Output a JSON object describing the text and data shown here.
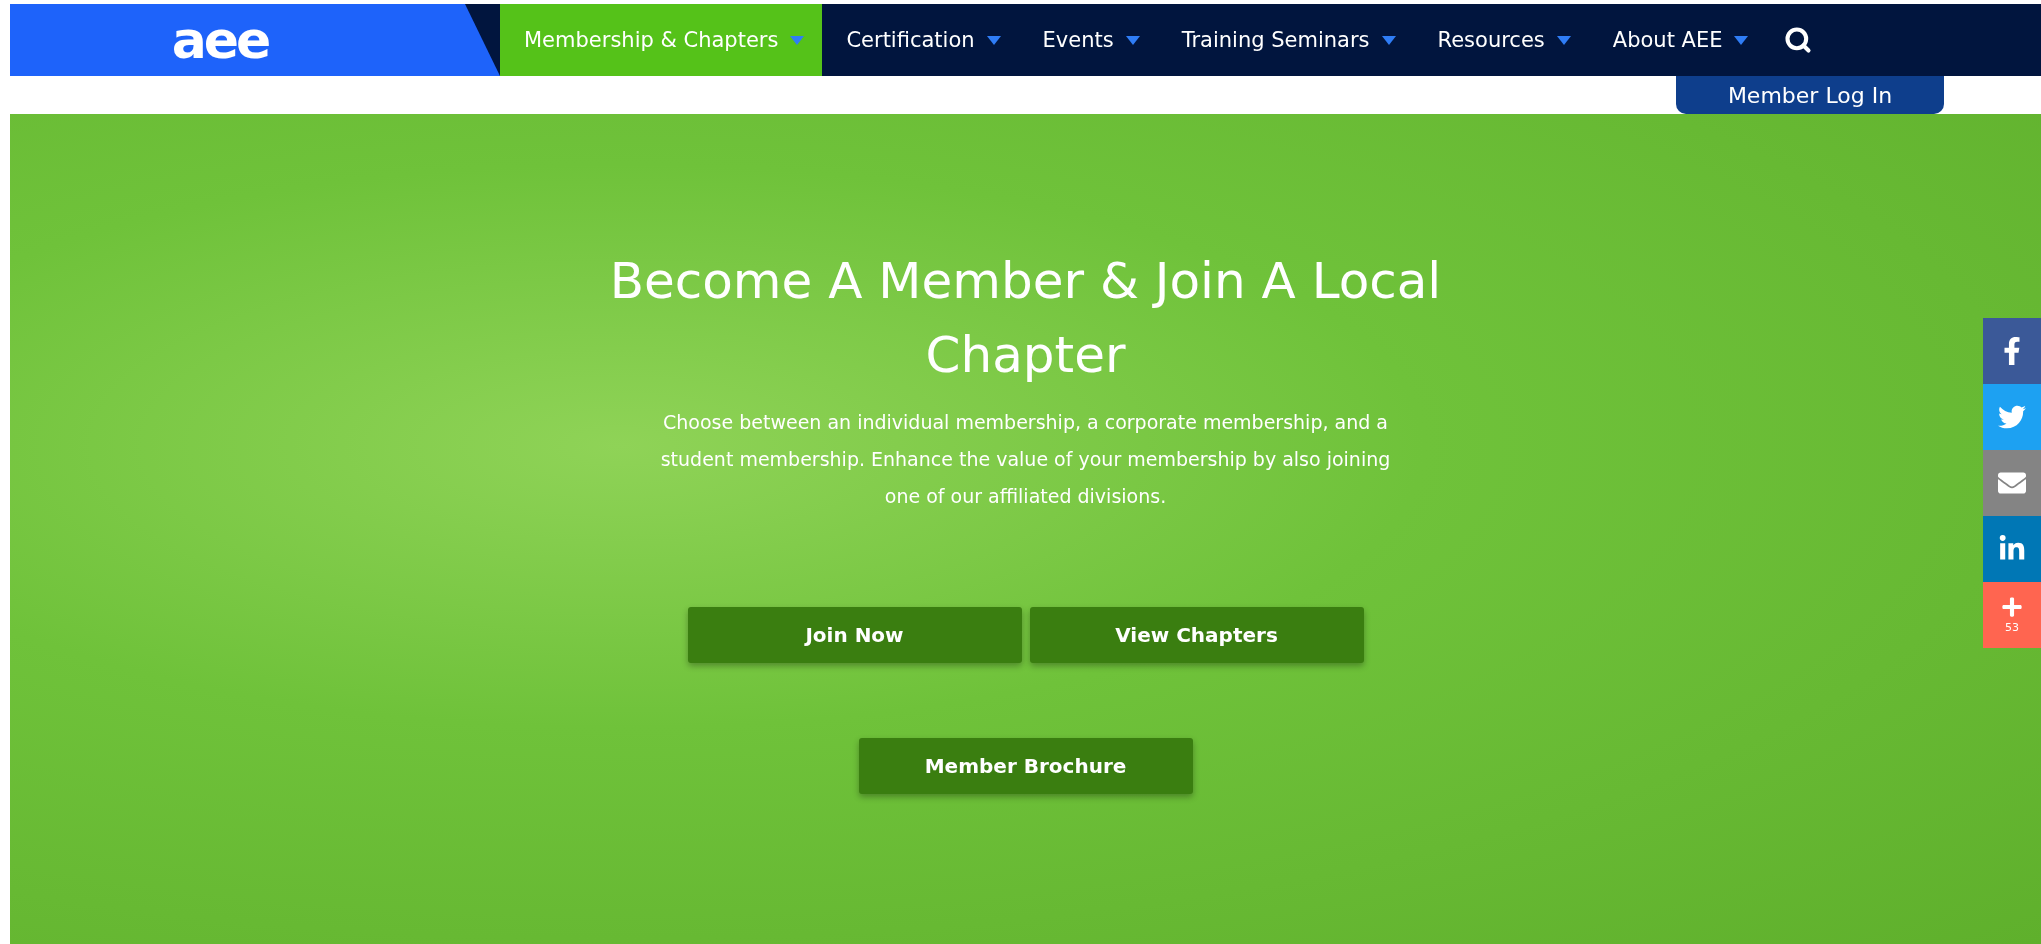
{
  "logo": {
    "text": "aee"
  },
  "nav": {
    "items": [
      {
        "label": "Membership & Chapters",
        "selected": true
      },
      {
        "label": "Certification",
        "selected": false
      },
      {
        "label": "Events",
        "selected": false
      },
      {
        "label": "Training Seminars",
        "selected": false
      },
      {
        "label": "Resources",
        "selected": false
      },
      {
        "label": "About AEE",
        "selected": false
      }
    ]
  },
  "login_button": "Member Log In",
  "hero": {
    "title": "Become A Member & Join A Local Chapter",
    "text": "Choose between an individual membership, a corporate membership, and a student membership. Enhance the value of your membership by also joining one of our affiliated divisions.",
    "button_rows": [
      [
        "Join Now",
        "View Chapters"
      ],
      [
        "Member Brochure"
      ]
    ]
  },
  "share": [
    {
      "kind": "facebook",
      "color": "#3b5998"
    },
    {
      "kind": "twitter",
      "color": "#1da1f2"
    },
    {
      "kind": "email",
      "color": "#848484"
    },
    {
      "kind": "linkedin",
      "color": "#0077b5"
    },
    {
      "kind": "more",
      "color": "#ff6550",
      "count": "53"
    }
  ]
}
